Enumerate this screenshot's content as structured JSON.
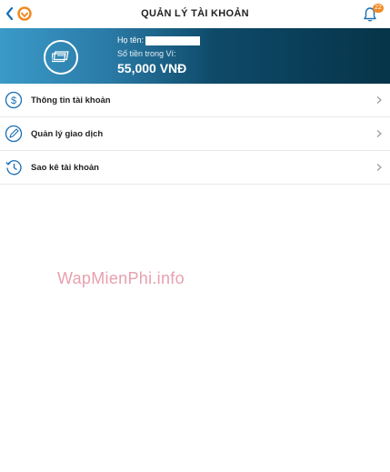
{
  "header": {
    "title": "QUẢN LÝ TÀI KHOẢN",
    "notification_count": "22"
  },
  "account": {
    "name_label": "Họ tên:",
    "balance_label": "Số tiền trong Ví:",
    "balance_value": "55,000 VNĐ"
  },
  "menu": {
    "items": [
      {
        "label": "Thông tin tài khoản",
        "icon": "dollar-icon"
      },
      {
        "label": "Quản lý giao dịch",
        "icon": "edit-icon"
      },
      {
        "label": "Sao kê tài khoản",
        "icon": "history-icon"
      }
    ]
  },
  "watermark": "WapMienPhi.info",
  "colors": {
    "accent": "#1a6fb5",
    "banner_start": "#3b9ac8",
    "banner_end": "#063449",
    "badge": "#f08a24"
  }
}
